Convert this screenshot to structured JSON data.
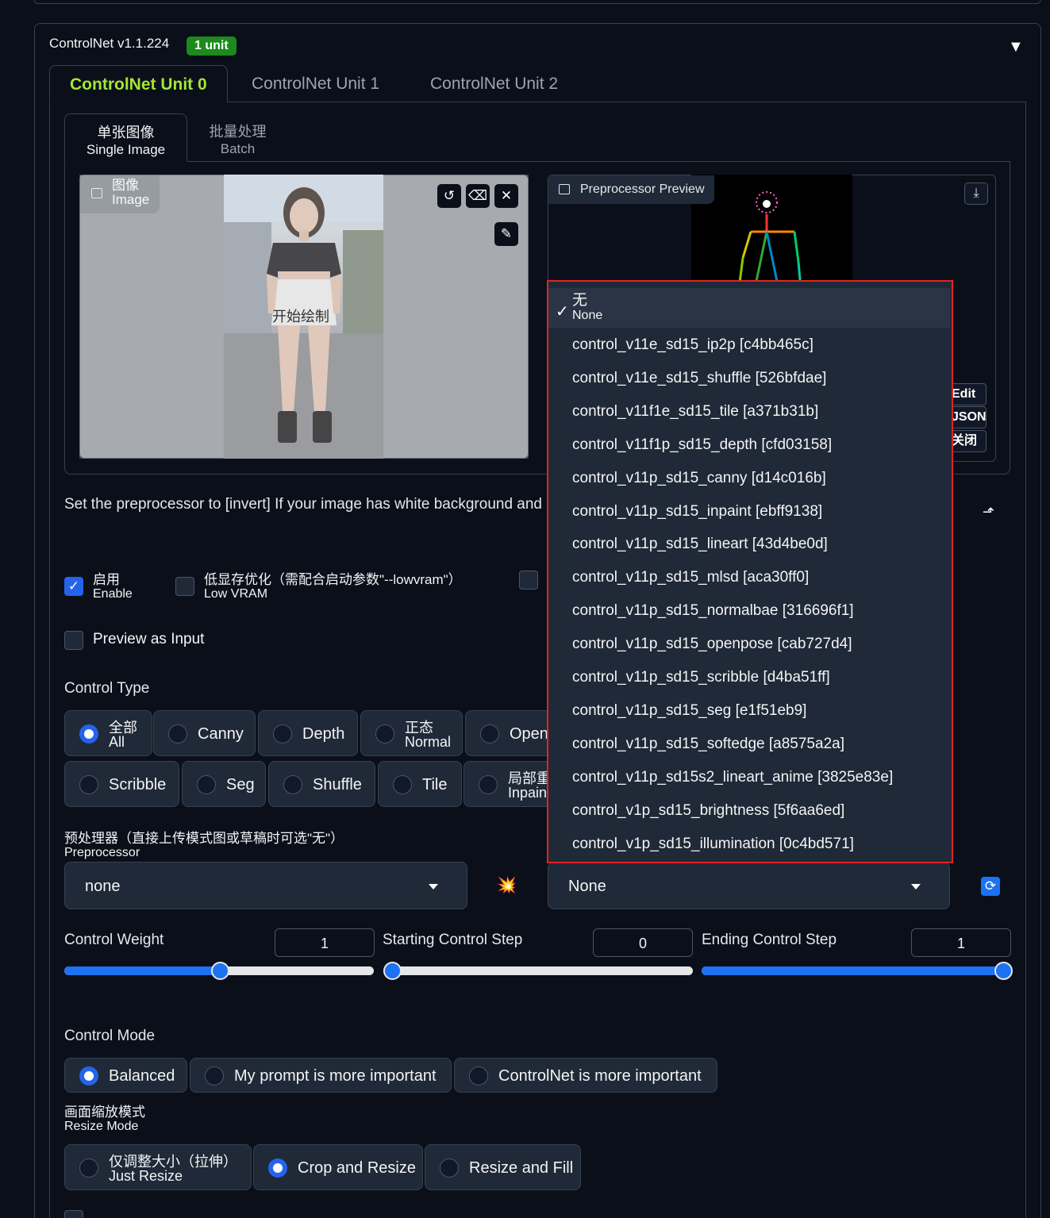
{
  "header": {
    "title": "ControlNet v1.1.224",
    "badge": "1 unit",
    "collapse_glyph": "▼"
  },
  "tabs": [
    "ControlNet Unit 0",
    "ControlNet Unit 1",
    "ControlNet Unit 2"
  ],
  "subtabs": [
    {
      "zh": "单张图像",
      "en": "Single Image"
    },
    {
      "zh": "批量处理",
      "en": "Batch"
    }
  ],
  "image_panel": {
    "label_zh": "图像",
    "label_en": "Image",
    "start_drawing": "开始绘制",
    "icons": [
      "undo-icon",
      "eraser-icon",
      "close-icon",
      "brush-icon"
    ]
  },
  "preview_panel": {
    "label": "Preprocessor Preview",
    "buttons": [
      "Edit",
      "JSON",
      "关闭"
    ]
  },
  "hint": "Set the preprocessor to [invert] If your image has white background and black lines.",
  "checkboxes": {
    "enable": {
      "zh": "启用",
      "en": "Enable",
      "checked": true
    },
    "lowvram": {
      "zh": "低显存优化（需配合启动参数\"--lowvram\"）",
      "en": "Low VRAM",
      "checked": false
    },
    "preview_as_input": {
      "label": "Preview as Input",
      "checked": false
    }
  },
  "control_type": {
    "title": "Control Type",
    "options_row1": [
      {
        "zh": "全部",
        "en": "All",
        "selected": true
      },
      {
        "label": "Canny"
      },
      {
        "label": "Depth"
      },
      {
        "zh": "正态",
        "en": "Normal"
      },
      {
        "label": "OpenPose"
      }
    ],
    "options_row2": [
      {
        "label": "Scribble"
      },
      {
        "label": "Seg"
      },
      {
        "label": "Shuffle"
      },
      {
        "label": "Tile"
      },
      {
        "zh": "局部重绘",
        "en": "Inpaint"
      }
    ]
  },
  "preprocessor": {
    "label_zh": "预处理器（直接上传模式图或草稿时可选\"无\"）",
    "label_en": "Preprocessor",
    "value": "none",
    "run_icon": "💥"
  },
  "model": {
    "value": "None",
    "refresh_icon": "refresh-icon"
  },
  "model_dropdown": {
    "selected_zh": "无",
    "selected_en": "None",
    "items": [
      "control_v11e_sd15_ip2p [c4bb465c]",
      "control_v11e_sd15_shuffle [526bfdae]",
      "control_v11f1e_sd15_tile [a371b31b]",
      "control_v11f1p_sd15_depth [cfd03158]",
      "control_v11p_sd15_canny [d14c016b]",
      "control_v11p_sd15_inpaint [ebff9138]",
      "control_v11p_sd15_lineart [43d4be0d]",
      "control_v11p_sd15_mlsd [aca30ff0]",
      "control_v11p_sd15_normalbae [316696f1]",
      "control_v11p_sd15_openpose [cab727d4]",
      "control_v11p_sd15_scribble [d4ba51ff]",
      "control_v11p_sd15_seg [e1f51eb9]",
      "control_v11p_sd15_softedge [a8575a2a]",
      "control_v11p_sd15s2_lineart_anime [3825e83e]",
      "control_v1p_sd15_brightness [5f6aa6ed]",
      "control_v1p_sd15_illumination [0c4bd571]"
    ]
  },
  "sliders": {
    "weight": {
      "label": "Control Weight",
      "value": "1",
      "fraction": 0.5
    },
    "start": {
      "label": "Starting Control Step",
      "value": "0",
      "fraction": 0.0
    },
    "end": {
      "label": "Ending Control Step",
      "value": "1",
      "fraction": 1.0
    }
  },
  "control_mode": {
    "title": "Control Mode",
    "options": [
      "Balanced",
      "My prompt is more important",
      "ControlNet is more important"
    ],
    "selected": "Balanced"
  },
  "resize_mode": {
    "title_zh": "画面缩放模式",
    "title_en": "Resize Mode",
    "options": [
      {
        "zh": "仅调整大小（拉伸）",
        "en": "Just Resize"
      },
      {
        "label": "Crop and Resize"
      },
      {
        "label": "Resize and Fill"
      }
    ],
    "selected": "Crop and Resize"
  },
  "colors": {
    "accent": "#2563eb",
    "active_tab": "#a3e635",
    "badge": "#1c8a1c",
    "highlight_border": "#e02424"
  }
}
